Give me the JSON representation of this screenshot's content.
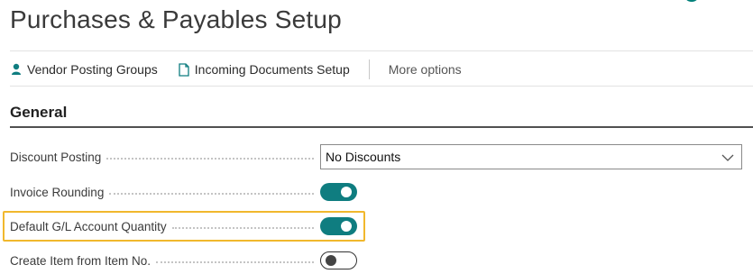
{
  "page": {
    "title": "Purchases & Payables Setup"
  },
  "actions": {
    "vendor_posting_groups": {
      "label": "Vendor Posting Groups",
      "icon": "person-icon"
    },
    "incoming_documents_setup": {
      "label": "Incoming Documents Setup",
      "icon": "document-icon"
    },
    "more_options": "More options"
  },
  "general": {
    "heading": "General",
    "fields": {
      "discount_posting": {
        "label": "Discount Posting",
        "value": "No Discounts"
      },
      "invoice_rounding": {
        "label": "Invoice Rounding",
        "value": true
      },
      "default_gl_account_quantity": {
        "label": "Default G/L Account Quantity",
        "value": true,
        "highlighted": true
      },
      "create_item_from_item_no": {
        "label": "Create Item from Item No.",
        "value": false
      }
    }
  },
  "colors": {
    "accent": "#0f7d80",
    "highlight": "#f1b82d"
  }
}
